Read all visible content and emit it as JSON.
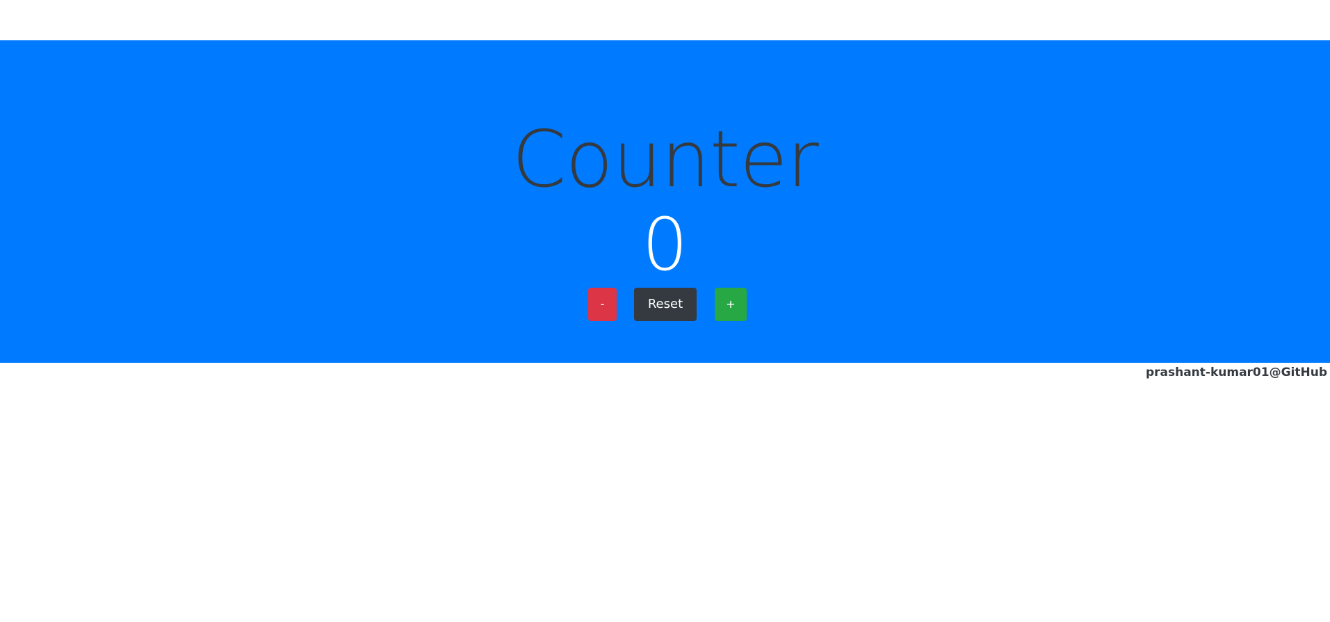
{
  "counter": {
    "title": "Counter",
    "value": "0"
  },
  "buttons": {
    "decrement_label": "-",
    "reset_label": "Reset",
    "increment_label": "+"
  },
  "footer": {
    "credit": "prashant-kumar01@GitHub"
  },
  "colors": {
    "banner": "#007bff",
    "decrement": "#dc3545",
    "reset": "#343a40",
    "increment": "#28a745",
    "title_text": "#343a40",
    "count_text": "#ffffff"
  }
}
